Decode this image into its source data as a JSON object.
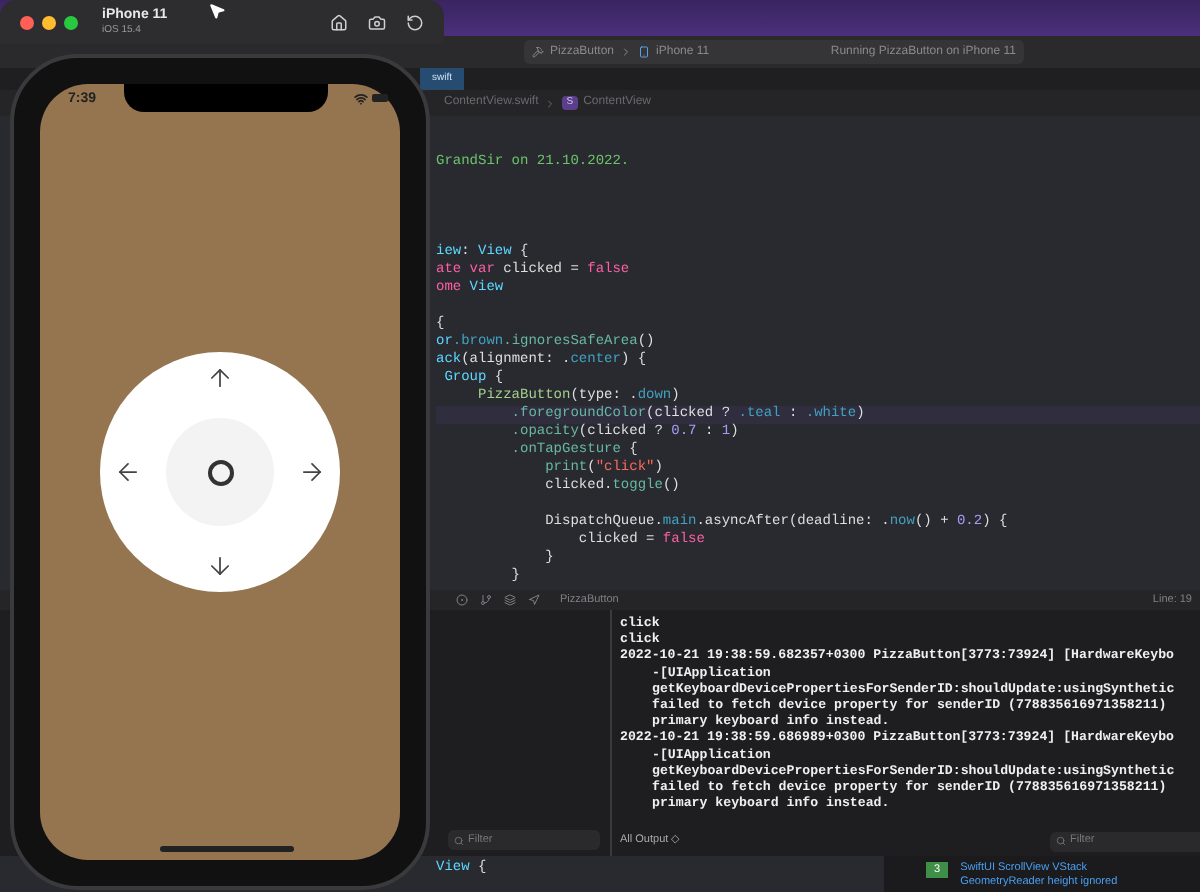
{
  "simulator": {
    "title": "iPhone 11",
    "subtitle": "iOS 15.4",
    "time": "7:39"
  },
  "toolbar": {
    "scheme": "PizzaButton",
    "device": "iPhone 11",
    "status": "Running PizzaButton on iPhone 11"
  },
  "tabs": [
    {
      "label": "swift",
      "selected": true
    }
  ],
  "jump_bar": {
    "file": "ContentView.swift",
    "symbol_badge": "S",
    "symbol": "ContentView"
  },
  "editor": {
    "lines": [
      {
        "kind": "blank"
      },
      {
        "kind": "blank"
      },
      {
        "kind": "code",
        "highlighted": false,
        "tokens": [
          {
            "text": "GrandSir on 21.10.2022.",
            "kind": "comment"
          }
        ]
      },
      {
        "kind": "blank"
      },
      {
        "kind": "blank"
      },
      {
        "kind": "blank"
      },
      {
        "kind": "blank"
      },
      {
        "kind": "code",
        "highlighted": false,
        "tokens": [
          {
            "text": "iew",
            "kind": "type"
          },
          {
            "text": ": ",
            "kind": "plain"
          },
          {
            "text": "View",
            "kind": "type"
          },
          {
            "text": " {",
            "kind": "plain"
          }
        ]
      },
      {
        "kind": "code",
        "highlighted": false,
        "tokens": [
          {
            "text": "ate var",
            "kind": "keyword"
          },
          {
            "text": " clicked = ",
            "kind": "plain"
          },
          {
            "text": "false",
            "kind": "keyword"
          }
        ]
      },
      {
        "kind": "code",
        "highlighted": false,
        "tokens": [
          {
            "text": "ome",
            "kind": "keyword"
          },
          {
            "text": " View",
            "kind": "type"
          }
        ]
      },
      {
        "kind": "blank"
      },
      {
        "kind": "code",
        "highlighted": false,
        "tokens": [
          {
            "text": "{",
            "kind": "plain"
          }
        ]
      },
      {
        "kind": "code",
        "highlighted": false,
        "tokens": [
          {
            "text": "or",
            "kind": "type"
          },
          {
            "text": ".brown",
            "kind": "member"
          },
          {
            "text": ".ignoresSafeArea",
            "kind": "call"
          },
          {
            "text": "()",
            "kind": "plain"
          }
        ]
      },
      {
        "kind": "code",
        "highlighted": false,
        "tokens": [
          {
            "text": "ack",
            "kind": "type"
          },
          {
            "text": "(alignment: .",
            "kind": "plain"
          },
          {
            "text": "center",
            "kind": "member"
          },
          {
            "text": ") {",
            "kind": "plain"
          }
        ]
      },
      {
        "kind": "code",
        "highlighted": false,
        "tokens": [
          {
            "text": " Group",
            "kind": "type"
          },
          {
            "text": " {",
            "kind": "plain"
          }
        ]
      },
      {
        "kind": "code",
        "highlighted": false,
        "tokens": [
          {
            "text": "     PizzaButton",
            "kind": "custom"
          },
          {
            "text": "(type: .",
            "kind": "plain"
          },
          {
            "text": "down",
            "kind": "member"
          },
          {
            "text": ")",
            "kind": "plain"
          }
        ]
      },
      {
        "kind": "code",
        "highlighted": true,
        "tokens": [
          {
            "text": "         .foregroundColor",
            "kind": "call"
          },
          {
            "text": "(clicked ? ",
            "kind": "plain"
          },
          {
            "text": ".teal",
            "kind": "member"
          },
          {
            "text": " : ",
            "kind": "plain"
          },
          {
            "text": ".white",
            "kind": "member"
          },
          {
            "text": ")",
            "kind": "plain"
          }
        ]
      },
      {
        "kind": "code",
        "highlighted": false,
        "tokens": [
          {
            "text": "         .opacity",
            "kind": "call"
          },
          {
            "text": "(clicked ? ",
            "kind": "plain"
          },
          {
            "text": "0.7",
            "kind": "number"
          },
          {
            "text": " : ",
            "kind": "plain"
          },
          {
            "text": "1",
            "kind": "number"
          },
          {
            "text": ")",
            "kind": "plain"
          }
        ]
      },
      {
        "kind": "code",
        "highlighted": false,
        "tokens": [
          {
            "text": "         .onTapGesture",
            "kind": "call"
          },
          {
            "text": " {",
            "kind": "plain"
          }
        ]
      },
      {
        "kind": "code",
        "highlighted": false,
        "tokens": [
          {
            "text": "             print",
            "kind": "call"
          },
          {
            "text": "(",
            "kind": "plain"
          },
          {
            "text": "\"click\"",
            "kind": "string"
          },
          {
            "text": ")",
            "kind": "plain"
          }
        ]
      },
      {
        "kind": "code",
        "highlighted": false,
        "tokens": [
          {
            "text": "             clicked.",
            "kind": "plain"
          },
          {
            "text": "toggle",
            "kind": "call"
          },
          {
            "text": "()",
            "kind": "plain"
          }
        ]
      },
      {
        "kind": "blank"
      },
      {
        "kind": "code",
        "highlighted": false,
        "tokens": [
          {
            "text": "             DispatchQueue.",
            "kind": "plain"
          },
          {
            "text": "main",
            "kind": "member"
          },
          {
            "text": ".asyncAfter(deadline: .",
            "kind": "plain"
          },
          {
            "text": "now",
            "kind": "member"
          },
          {
            "text": "() + ",
            "kind": "plain"
          },
          {
            "text": "0.2",
            "kind": "number"
          },
          {
            "text": ") {",
            "kind": "plain"
          }
        ]
      },
      {
        "kind": "code",
        "highlighted": false,
        "tokens": [
          {
            "text": "                 clicked = ",
            "kind": "plain"
          },
          {
            "text": "false",
            "kind": "keyword"
          }
        ]
      },
      {
        "kind": "code",
        "highlighted": false,
        "tokens": [
          {
            "text": "             }",
            "kind": "plain"
          }
        ]
      },
      {
        "kind": "code",
        "highlighted": false,
        "tokens": [
          {
            "text": "         }",
            "kind": "plain"
          }
        ]
      }
    ]
  },
  "debug_bar": {
    "target": "PizzaButton",
    "position": "Line: 19"
  },
  "variables": {
    "filter_placeholder": "Filter"
  },
  "console": {
    "lines": [
      {
        "text": "click",
        "wrapped": false
      },
      {
        "text": "click",
        "wrapped": false
      },
      {
        "text": "2022-10-21 19:38:59.682357+0300 PizzaButton[3773:73924] [HardwareKeybo",
        "wrapped": false
      },
      {
        "text": "-[UIApplication",
        "wrapped": true
      },
      {
        "text": "getKeyboardDevicePropertiesForSenderID:shouldUpdate:usingSynthetic",
        "wrapped": true
      },
      {
        "text": "failed to fetch device property for senderID (778835616971358211)",
        "wrapped": true
      },
      {
        "text": "primary keyboard info instead.",
        "wrapped": true
      },
      {
        "text": "2022-10-21 19:38:59.686989+0300 PizzaButton[3773:73924] [HardwareKeybo",
        "wrapped": false
      },
      {
        "text": "-[UIApplication",
        "wrapped": true
      },
      {
        "text": "getKeyboardDevicePropertiesForSenderID:shouldUpdate:usingSynthetic",
        "wrapped": true
      },
      {
        "text": "failed to fetch device property for senderID (778835616971358211)",
        "wrapped": true
      },
      {
        "text": "primary keyboard info instead.",
        "wrapped": true
      }
    ],
    "output_menu": "All Output ◇",
    "filter_placeholder": "Filter"
  },
  "bottom_code": {
    "tokens": [
      {
        "text": "View",
        "kind": "type"
      },
      {
        "text": " {",
        "kind": "plain"
      }
    ]
  },
  "issue": {
    "count": "3",
    "lines": [
      "SwiftUI ScrollView VStack",
      "GeometryReader height ignored"
    ]
  }
}
